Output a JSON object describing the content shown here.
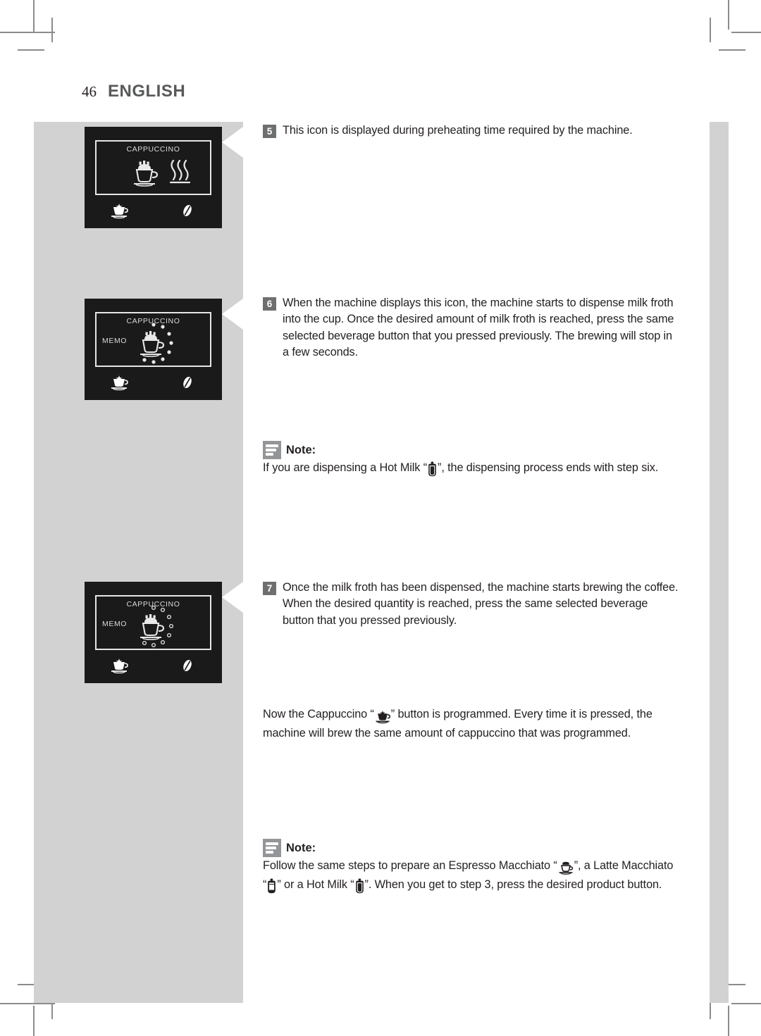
{
  "page": {
    "number": "46",
    "language": "ENGLISH"
  },
  "displays": [
    {
      "id": "display-preheating",
      "title": "CAPPUCCINO",
      "memo": "",
      "icons": [
        "cappuccino-cup-icon",
        "steam-waves-icon"
      ],
      "buttons": [
        "cappuccino-button-icon",
        "coffee-bean-icon"
      ]
    },
    {
      "id": "display-milk-froth",
      "title": "CAPPUCCINO",
      "memo": "MEMO",
      "icons": [
        "cappuccino-cup-icon",
        "progress-dots-filled-icon"
      ],
      "buttons": [
        "cappuccino-button-icon",
        "coffee-bean-icon"
      ]
    },
    {
      "id": "display-brewing",
      "title": "CAPPUCCINO",
      "memo": "MEMO",
      "icons": [
        "cappuccino-cup-icon",
        "progress-dots-hollow-icon"
      ],
      "buttons": [
        "cappuccino-button-icon",
        "coffee-bean-icon"
      ]
    }
  ],
  "steps": [
    {
      "number": "5",
      "text": "This icon is displayed during preheating time required by the machine."
    },
    {
      "number": "6",
      "text": "When the machine displays this icon, the machine starts to dispense milk froth into the cup. Once the desired amount of milk froth is reached, press the same selected beverage button that you pressed previously. The brewing will stop in a few seconds."
    },
    {
      "number": "7",
      "text": "Once the milk froth has been dispensed, the machine starts brewing the coffee. When the desired quantity is reached, press the same selected beverage button that you pressed previously."
    }
  ],
  "notes": [
    {
      "label": "Note:",
      "text_before": "If you are dispensing a Hot Milk “",
      "icon": "hot-milk-glass-icon",
      "text_after": "”, the dispensing process ends with step six."
    },
    {
      "label": "Note:",
      "text_1": "Follow the same steps to prepare an Espresso Macchiato “",
      "icon_1": "espresso-macchiato-cup-icon",
      "text_2": "”, a Latte Macchiato “",
      "icon_2": "latte-macchiato-glass-icon",
      "text_3": "” or a Hot Milk “",
      "icon_3": "hot-milk-glass-icon",
      "text_4": "”. When you get to step 3, press the desired product button."
    }
  ],
  "paragraph": {
    "text_before": "Now the Cappuccino “",
    "icon": "cappuccino-button-icon",
    "text_after": "” button is programmed. Every time it is pressed, the machine will brew the same amount of cappuccino that was programmed."
  },
  "colors": {
    "gray_column": "#d2d2d2",
    "display_bg": "#1a1a1a",
    "step_badge": "#6e6f71",
    "note_badge": "#939598",
    "text": "#231f20",
    "heading": "#58595b"
  }
}
